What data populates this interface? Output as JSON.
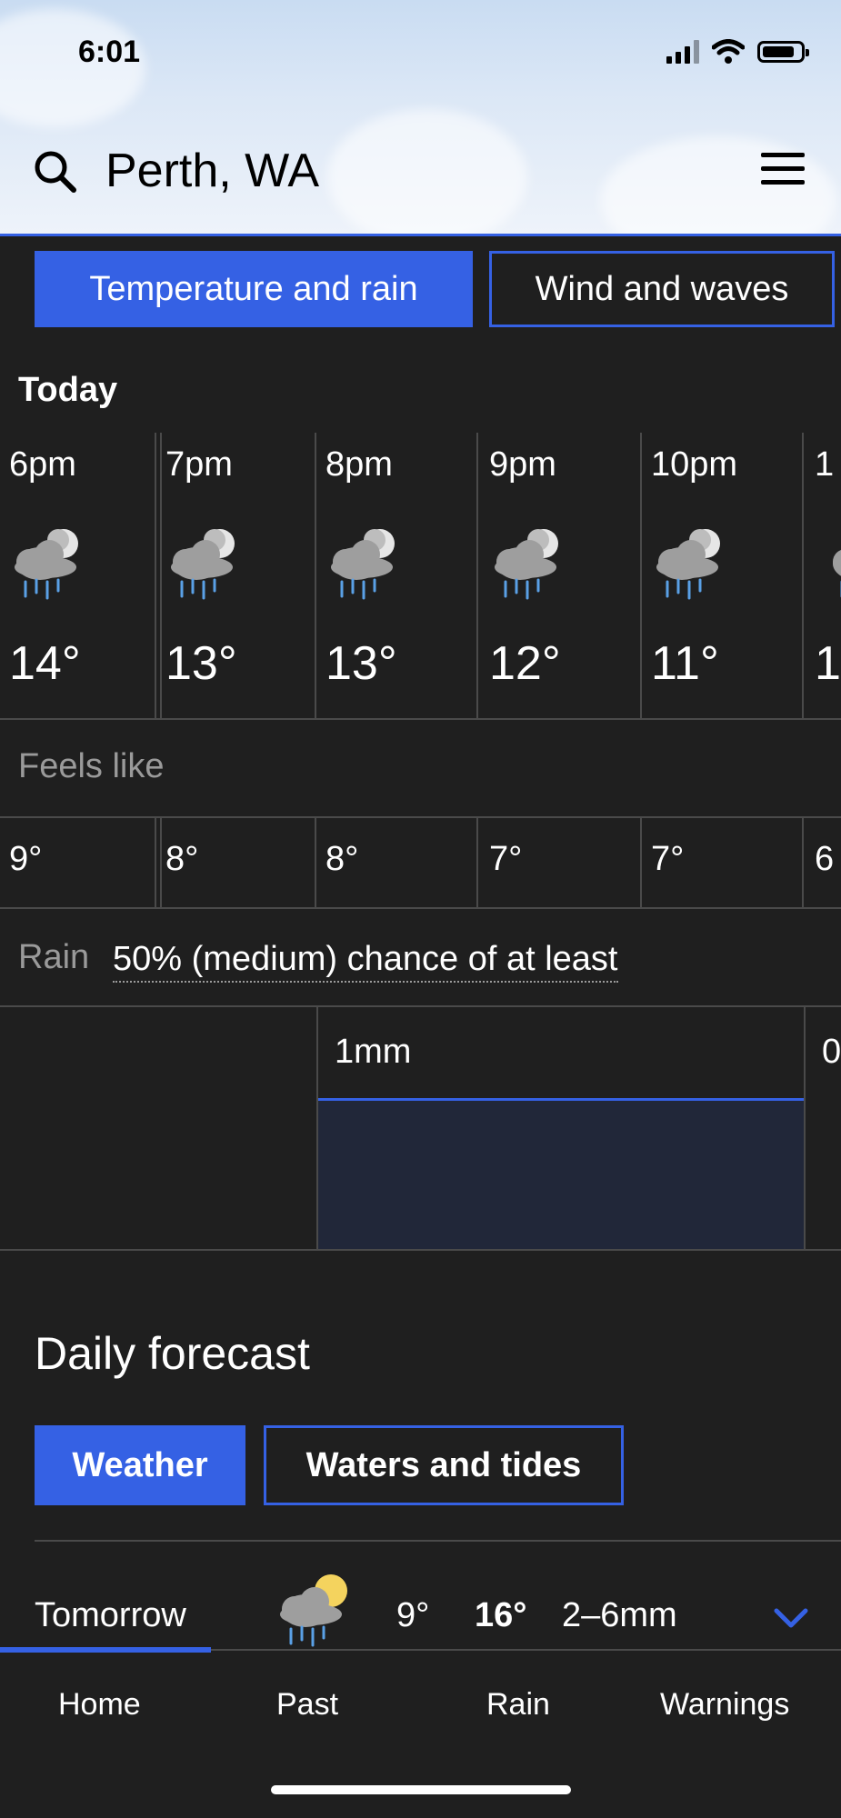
{
  "status": {
    "time": "6:01"
  },
  "header": {
    "location": "Perth, WA"
  },
  "tabs": [
    {
      "label": "Temperature and rain",
      "active": true
    },
    {
      "label": "Wind and waves",
      "active": false
    }
  ],
  "today": {
    "title": "Today",
    "hours": [
      {
        "time": "6pm",
        "temp": "14°",
        "feels": "9°",
        "icon": "rain-night-icon"
      },
      {
        "time": "7pm",
        "temp": "13°",
        "feels": "8°",
        "icon": "rain-night-icon"
      },
      {
        "time": "8pm",
        "temp": "13°",
        "feels": "8°",
        "icon": "rain-night-icon"
      },
      {
        "time": "9pm",
        "temp": "12°",
        "feels": "7°",
        "icon": "rain-night-icon"
      },
      {
        "time": "10pm",
        "temp": "11°",
        "feels": "7°",
        "icon": "rain-night-icon"
      },
      {
        "time": "1",
        "temp": "1",
        "feels": "6",
        "icon": "rain-night-icon"
      }
    ],
    "feels_label": "Feels like",
    "rain_label": "Rain",
    "rain_text": "50% (medium) chance of at least",
    "rain_amounts": [
      "1mm",
      "0"
    ]
  },
  "daily": {
    "title": "Daily forecast",
    "tabs": [
      {
        "label": "Weather",
        "active": true
      },
      {
        "label": "Waters and tides",
        "active": false
      }
    ],
    "rows": [
      {
        "day": "Tomorrow",
        "min": "9°",
        "max": "16°",
        "rain": "2–6mm",
        "icon": "rain-sun-icon"
      }
    ]
  },
  "nav": [
    {
      "label": "Home",
      "active": true
    },
    {
      "label": "Past",
      "active": false
    },
    {
      "label": "Rain",
      "active": false
    },
    {
      "label": "Warnings",
      "active": false
    }
  ],
  "colors": {
    "accent": "#3561e4",
    "background": "#1f1f1f"
  }
}
